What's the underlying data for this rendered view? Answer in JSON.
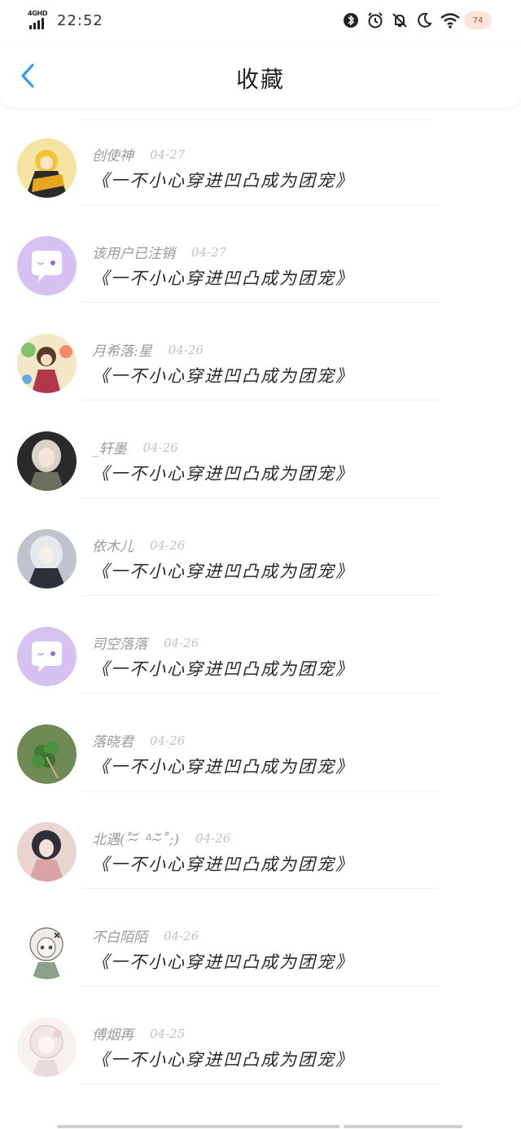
{
  "status_bar": {
    "network": "4GHD",
    "time": "22:52",
    "battery_badge": "74"
  },
  "header": {
    "title": "收藏",
    "back_icon": "chevron-left-icon",
    "accent_color": "#2f9df4"
  },
  "items": [
    {
      "username": "创使神",
      "date": "04-27",
      "title": "《一不小心穿进凹凸成为团宠》",
      "avatar": "anime-yellow"
    },
    {
      "username": "该用户已注销",
      "date": "04-27",
      "title": "《一不小心穿进凹凸成为团宠》",
      "avatar": "default-chat"
    },
    {
      "username": "月希落:星",
      "date": "04-26",
      "title": "《一不小心穿进凹凸成为团宠》",
      "avatar": "anime-colorful"
    },
    {
      "username": "_轩墨",
      "date": "04-26",
      "title": "《一不小心穿进凹凸成为团宠》",
      "avatar": "anime-dark"
    },
    {
      "username": "依木儿",
      "date": "04-26",
      "title": "《一不小心穿进凹凸成为团宠》",
      "avatar": "anime-silver"
    },
    {
      "username": "司空落落",
      "date": "04-26",
      "title": "《一不小心穿进凹凸成为团宠》",
      "avatar": "default-chat"
    },
    {
      "username": "落晓君",
      "date": "04-26",
      "title": "《一不小心穿进凹凸成为团宠》",
      "avatar": "clover"
    },
    {
      "username": "北遇(˚‾̴᷄ ᐞ ‾̴᷅˚;)",
      "date": "04-26",
      "title": "《一不小心穿进凹凸成为团宠》",
      "avatar": "anime-pink"
    },
    {
      "username": "不白陌陌",
      "date": "04-26",
      "title": "《一不小心穿进凹凸成为团宠》",
      "avatar": "anime-white"
    },
    {
      "username": "傅烟再",
      "date": "04-25",
      "title": "《一不小心穿进凹凸成为团宠》",
      "avatar": "anime-light"
    }
  ],
  "colors": {
    "default_avatar_bg": "#d5c2f3",
    "title_text": "#2a2a2a",
    "username_text": "#9a9a9a",
    "date_text": "#c2c2c2"
  }
}
